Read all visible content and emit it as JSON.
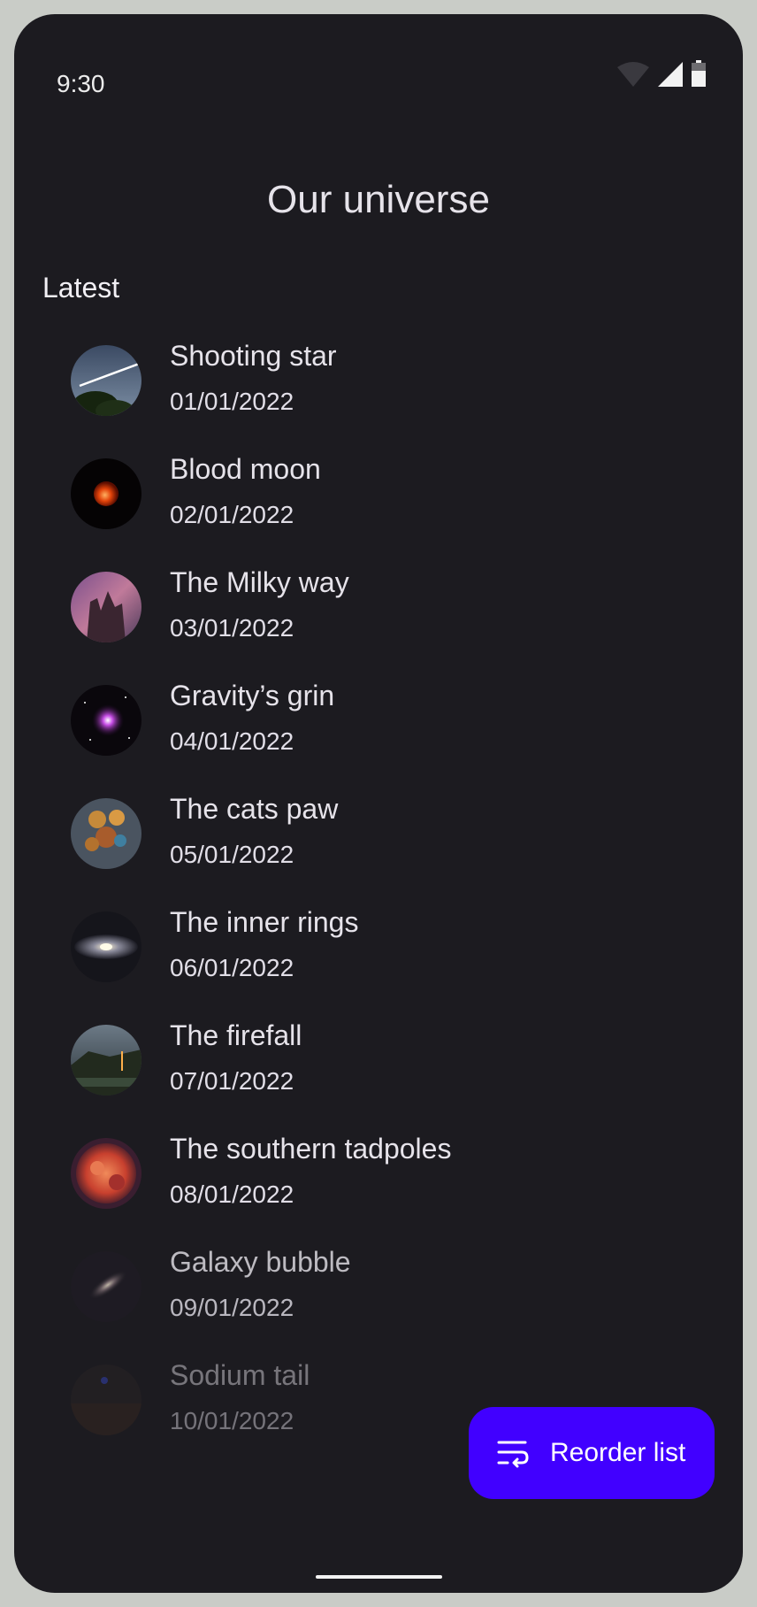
{
  "status_bar": {
    "time": "9:30",
    "icons": [
      "wifi-icon",
      "cell-signal-icon",
      "battery-icon"
    ]
  },
  "header": {
    "title": "Our universe"
  },
  "section": {
    "label": "Latest"
  },
  "items": [
    {
      "title": "Shooting star",
      "date": "01/01/2022",
      "image": "shooting-star-thumbnail"
    },
    {
      "title": "Blood moon",
      "date": "02/01/2022",
      "image": "blood-moon-thumbnail"
    },
    {
      "title": "The Milky way",
      "date": "03/01/2022",
      "image": "milky-way-thumbnail"
    },
    {
      "title": "Gravity’s grin",
      "date": "04/01/2022",
      "image": "gravitys-grin-thumbnail"
    },
    {
      "title": "The cats paw",
      "date": "05/01/2022",
      "image": "cats-paw-thumbnail"
    },
    {
      "title": "The inner rings",
      "date": "06/01/2022",
      "image": "inner-rings-thumbnail"
    },
    {
      "title": "The firefall",
      "date": "07/01/2022",
      "image": "firefall-thumbnail"
    },
    {
      "title": "The southern tadpoles",
      "date": "08/01/2022",
      "image": "southern-tadpoles-thumbnail"
    },
    {
      "title": "Galaxy bubble",
      "date": "09/01/2022",
      "image": "galaxy-bubble-thumbnail"
    },
    {
      "title": "Sodium tail",
      "date": "10/01/2022",
      "image": "sodium-tail-thumbnail"
    }
  ],
  "fab": {
    "label": "Reorder list",
    "icon": "reorder-icon"
  },
  "colors": {
    "background": "#1c1b20",
    "accent": "#4100ff",
    "text": "#e6e3ea"
  }
}
